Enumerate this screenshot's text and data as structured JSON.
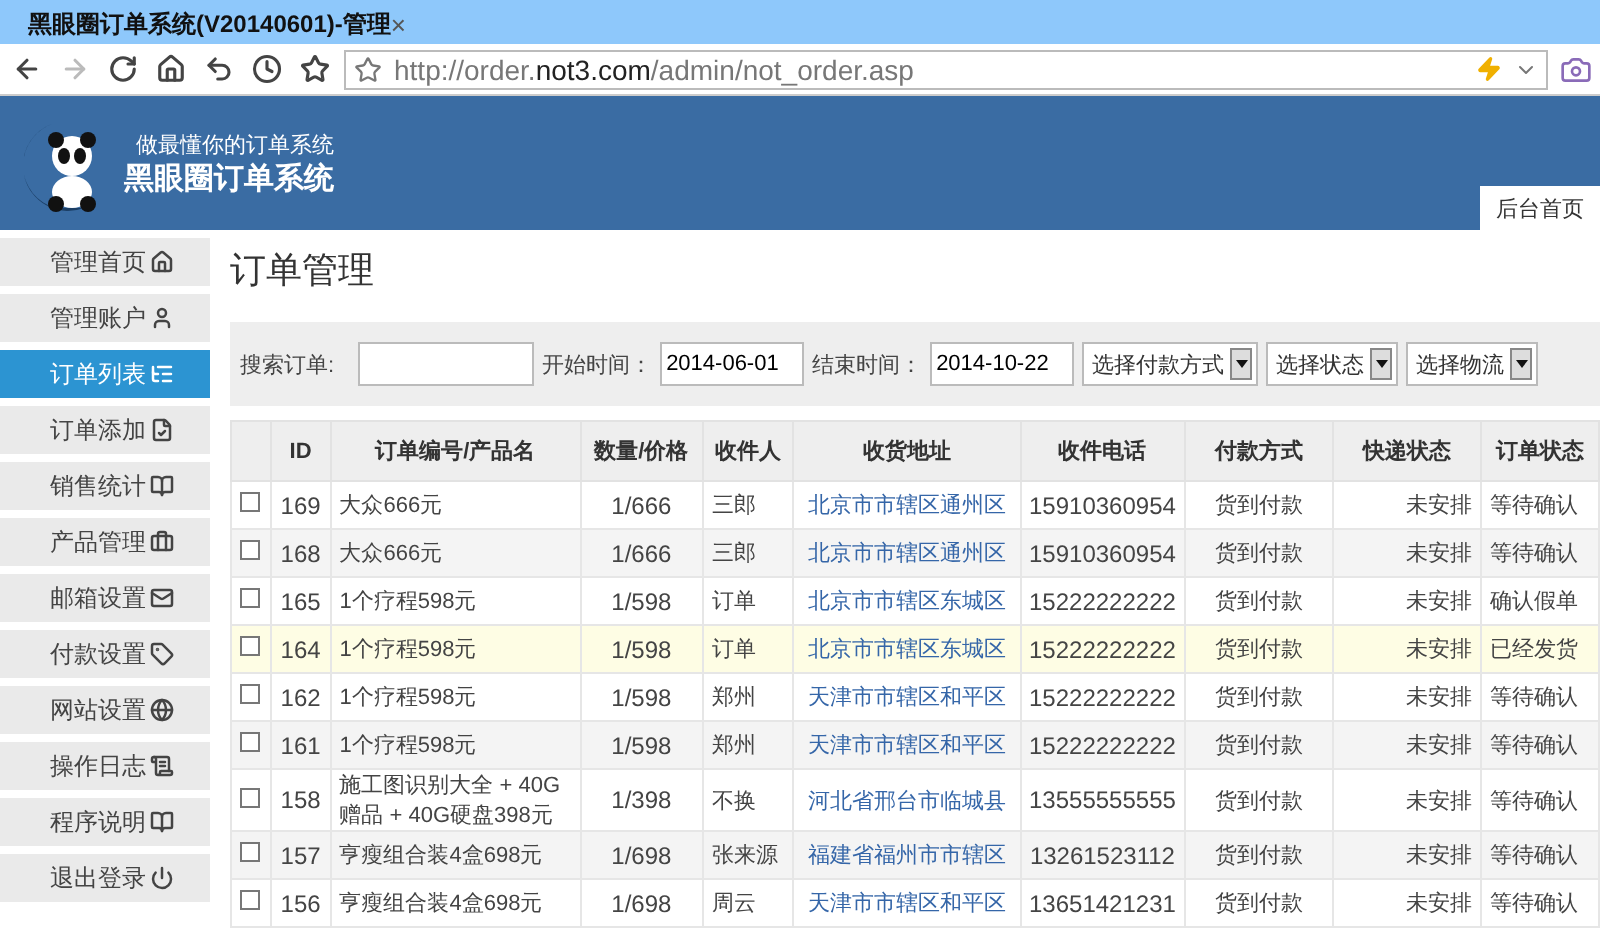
{
  "browser": {
    "tab_title": "黑眼圈订单系统(V20140601)-管理",
    "tab_close": "×",
    "url_prefix": "http://order.",
    "url_domain": "not3.com",
    "url_path": "/admin/not_order.asp",
    "nav": [
      {
        "kind": "back",
        "disabled": false
      },
      {
        "kind": "forward",
        "disabled": true
      },
      {
        "kind": "refresh",
        "disabled": false
      },
      {
        "kind": "home",
        "disabled": false
      },
      {
        "kind": "undo",
        "disabled": false
      },
      {
        "kind": "history",
        "disabled": false
      },
      {
        "kind": "bookmark",
        "disabled": false
      }
    ]
  },
  "header": {
    "slogan": "做最懂你的订单系统",
    "title": "黑眼圈订单系统",
    "home_tab": "后台首页"
  },
  "sidebar": {
    "items": [
      {
        "label": "管理首页",
        "selected": false
      },
      {
        "label": "管理账户",
        "selected": false
      },
      {
        "label": "订单列表",
        "selected": true
      },
      {
        "label": "订单添加",
        "selected": false
      },
      {
        "label": "销售统计",
        "selected": false
      },
      {
        "label": "产品管理",
        "selected": false
      },
      {
        "label": "邮箱设置",
        "selected": false
      },
      {
        "label": "付款设置",
        "selected": false
      },
      {
        "label": "网站设置",
        "selected": false
      },
      {
        "label": "操作日志",
        "selected": false
      },
      {
        "label": "程序说明",
        "selected": false
      },
      {
        "label": "退出登录",
        "selected": false
      }
    ]
  },
  "page_title": "订单管理",
  "search": {
    "label": "搜索订单:",
    "start_label": "开始时间：",
    "start_value": "2014-06-01",
    "end_label": "结束时间：",
    "end_value": "2014-10-22",
    "selects": [
      "选择付款方式",
      "选择状态",
      "选择物流"
    ]
  },
  "table": {
    "columns": [
      "ID",
      "订单编号/产品名",
      "数量/价格",
      "收件人",
      "收货地址",
      "收件电话",
      "付款方式",
      "快递状态",
      "订单状态"
    ],
    "rows": [
      {
        "checked": false,
        "highlighted": false,
        "cells": [
          "169",
          "大众666元",
          "1/666",
          "三郎",
          "北京市市辖区通州区",
          "15910360954",
          "货到付款",
          "未安排",
          "等待确认"
        ]
      },
      {
        "checked": false,
        "highlighted": false,
        "cells": [
          "168",
          "大众666元",
          "1/666",
          "三郎",
          "北京市市辖区通州区",
          "15910360954",
          "货到付款",
          "未安排",
          "等待确认"
        ]
      },
      {
        "checked": false,
        "highlighted": false,
        "cells": [
          "165",
          "1个疗程598元",
          "1/598",
          "订单",
          "北京市市辖区东城区",
          "15222222222",
          "货到付款",
          "未安排",
          "确认假单"
        ]
      },
      {
        "checked": false,
        "highlighted": true,
        "cells": [
          "164",
          "1个疗程598元",
          "1/598",
          "订单",
          "北京市市辖区东城区",
          "15222222222",
          "货到付款",
          "未安排",
          "已经发货"
        ]
      },
      {
        "checked": false,
        "highlighted": false,
        "cells": [
          "162",
          "1个疗程598元",
          "1/598",
          "郑州",
          "天津市市辖区和平区",
          "15222222222",
          "货到付款",
          "未安排",
          "等待确认"
        ]
      },
      {
        "checked": false,
        "highlighted": false,
        "cells": [
          "161",
          "1个疗程598元",
          "1/598",
          "郑州",
          "天津市市辖区和平区",
          "15222222222",
          "货到付款",
          "未安排",
          "等待确认"
        ]
      },
      {
        "checked": false,
        "highlighted": false,
        "cells": [
          "158",
          "施工图识别大全 + 40G赠品 + 40G硬盘398元",
          "1/398",
          "不换",
          "河北省邢台市临城县",
          "13555555555",
          "货到付款",
          "未安排",
          "等待确认"
        ]
      },
      {
        "checked": false,
        "highlighted": false,
        "cells": [
          "157",
          "亨瘦组合装4盒698元",
          "1/698",
          "张来源",
          "福建省福州市市辖区",
          "13261523112",
          "货到付款",
          "未安排",
          "等待确认"
        ]
      },
      {
        "checked": false,
        "highlighted": false,
        "cells": [
          "156",
          "亨瘦组合装4盒698元",
          "1/698",
          "周云",
          "天津市市辖区和平区",
          "13651421231",
          "货到付款",
          "未安排",
          "等待确认"
        ]
      }
    ]
  }
}
